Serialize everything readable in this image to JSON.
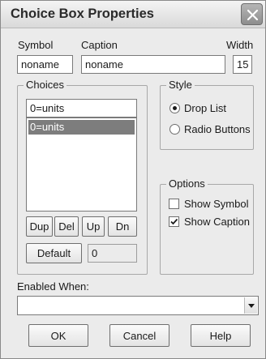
{
  "window": {
    "title": "Choice Box Properties"
  },
  "labels": {
    "symbol": "Symbol",
    "caption": "Caption",
    "width": "Width",
    "enabled_when": "Enabled When:"
  },
  "fields": {
    "symbol": "noname",
    "caption": "noname",
    "width": "15",
    "choice_edit": "0=units",
    "default_value": "0",
    "enabled_when": ""
  },
  "choices": {
    "title": "Choices",
    "items": [
      "0=units"
    ],
    "selected_index": 0,
    "buttons": {
      "dup": "Dup",
      "del": "Del",
      "up": "Up",
      "dn": "Dn",
      "default": "Default"
    }
  },
  "style": {
    "title": "Style",
    "options": [
      "Drop List",
      "Radio Buttons"
    ],
    "selected": "Drop List"
  },
  "options": {
    "title": "Options",
    "show_symbol": {
      "label": "Show Symbol",
      "checked": false
    },
    "show_caption": {
      "label": "Show Caption",
      "checked": true
    }
  },
  "footer": {
    "ok": "OK",
    "cancel": "Cancel",
    "help": "Help"
  },
  "icons": {
    "close": "close-icon",
    "dropdown": "chevron-down-icon",
    "check": "checkmark-icon"
  }
}
